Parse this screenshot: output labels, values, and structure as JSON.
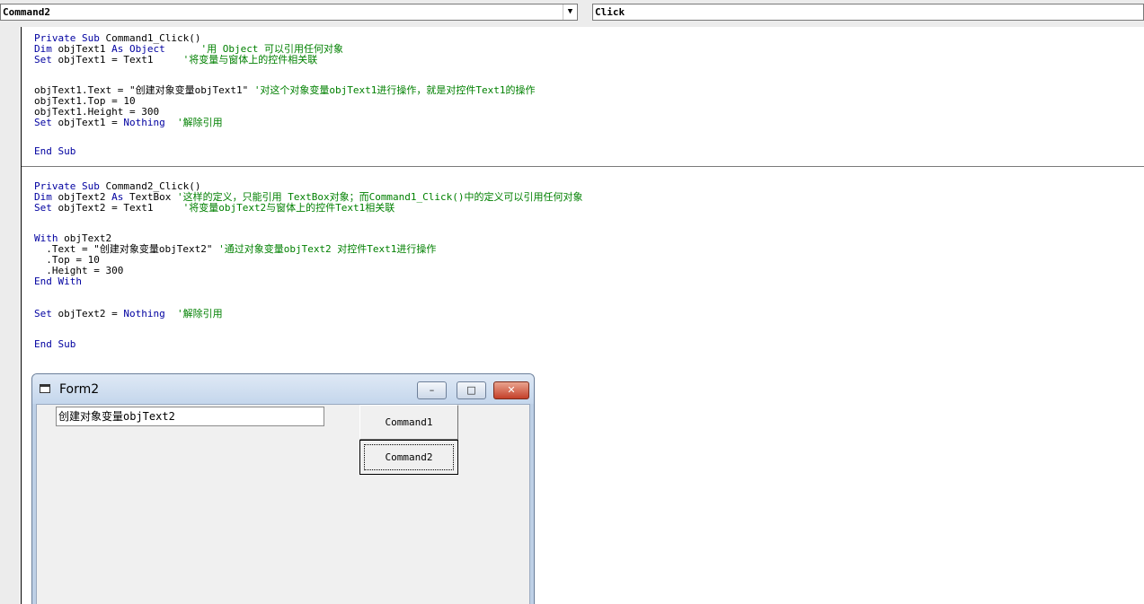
{
  "object_combo": {
    "value": "Command2",
    "arrow": "▼"
  },
  "procedure_combo": {
    "value": "Click"
  },
  "code": {
    "proc1": [
      [
        {
          "t": "Private Sub ",
          "c": "kw"
        },
        {
          "t": "Command1_Click()",
          "c": ""
        }
      ],
      [
        {
          "t": "Dim ",
          "c": "kw"
        },
        {
          "t": "objText1 ",
          "c": ""
        },
        {
          "t": "As Object",
          "c": "kw"
        },
        {
          "t": "      '用 Object 可以引用任何对象",
          "c": "cm"
        }
      ],
      [
        {
          "t": "Set ",
          "c": "kw"
        },
        {
          "t": "objText1 = Text1",
          "c": ""
        },
        {
          "t": "     '将变量与窗体上的控件相关联",
          "c": "cm"
        }
      ],
      [],
      [
        {
          "t": "objText1.Text = \"创建对象变量objText1\" ",
          "c": ""
        },
        {
          "t": "'对这个对象变量objText1进行操作，就是对控件Text1的操作",
          "c": "cm"
        }
      ],
      [
        {
          "t": "objText1.Top = 10",
          "c": ""
        }
      ],
      [
        {
          "t": "objText1.Height = 300",
          "c": ""
        }
      ],
      [
        {
          "t": "Set ",
          "c": "kw"
        },
        {
          "t": "objText1 = ",
          "c": ""
        },
        {
          "t": "Nothing",
          "c": "kw"
        },
        {
          "t": "  '解除引用",
          "c": "cm"
        }
      ],
      [],
      [
        {
          "t": "End Sub",
          "c": "kw"
        }
      ]
    ],
    "proc2": [
      [
        {
          "t": "Private Sub ",
          "c": "kw"
        },
        {
          "t": "Command2_Click()",
          "c": ""
        }
      ],
      [
        {
          "t": "Dim ",
          "c": "kw"
        },
        {
          "t": "objText2 ",
          "c": ""
        },
        {
          "t": "As ",
          "c": "kw"
        },
        {
          "t": "TextBox",
          "c": ""
        },
        {
          "t": " '这样的定义，只能引用 TextBox对象；而Command1_Click()中的定义可以引用任何对象",
          "c": "cm"
        }
      ],
      [
        {
          "t": "Set ",
          "c": "kw"
        },
        {
          "t": "objText2 = Text1",
          "c": ""
        },
        {
          "t": "     '将变量objText2与窗体上的控件Text1相关联",
          "c": "cm"
        }
      ],
      [],
      [
        {
          "t": "With ",
          "c": "kw"
        },
        {
          "t": "objText2",
          "c": ""
        }
      ],
      [
        {
          "t": "  .Text = \"创建对象变量objText2\" ",
          "c": ""
        },
        {
          "t": "'通过对象变量objText2 对控件Text1进行操作",
          "c": "cm"
        }
      ],
      [
        {
          "t": "  .Top = 10",
          "c": ""
        }
      ],
      [
        {
          "t": "  .Height = 300",
          "c": ""
        }
      ],
      [
        {
          "t": "End With",
          "c": "kw"
        }
      ],
      [],
      [
        {
          "t": "Set ",
          "c": "kw"
        },
        {
          "t": "objText2 = ",
          "c": ""
        },
        {
          "t": "Nothing",
          "c": "kw"
        },
        {
          "t": "  '解除引用",
          "c": "cm"
        }
      ],
      [],
      [
        {
          "t": "End Sub",
          "c": "kw"
        }
      ]
    ]
  },
  "form": {
    "title": "Form2",
    "minimize_glyph": "–",
    "maximize_glyph": "□",
    "close_glyph": "✕",
    "textbox_value": "创建对象变量objText2",
    "button1_label": "Command1",
    "button2_label": "Command2"
  }
}
